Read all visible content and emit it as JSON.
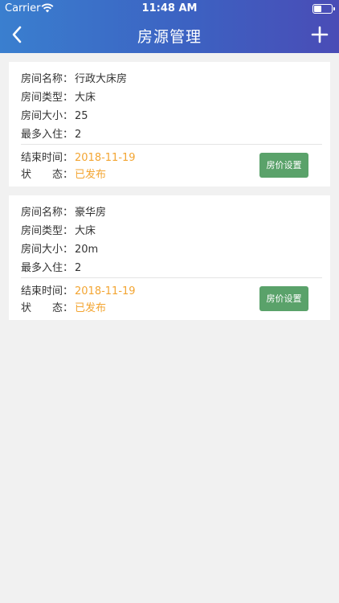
{
  "status_bar": {
    "carrier": "Carrier",
    "time": "11:48 AM"
  },
  "nav": {
    "title": "房源管理",
    "back_icon": "chevron-left-icon",
    "add_icon": "plus-icon"
  },
  "rooms": [
    {
      "name_label": "房间名称：",
      "name": "行政大床房",
      "type_label": "房间类型：",
      "type": "大床",
      "size_label": "房间大小：",
      "size": "25",
      "max_label": "最多入住：",
      "max": "2",
      "end_label": "结束时间：",
      "end_time": "2018-11-19",
      "status_label": "状　　态：",
      "status": "已发布",
      "button": "房价设置"
    },
    {
      "name_label": "房间名称：",
      "name": "豪华房",
      "type_label": "房间类型：",
      "type": "大床",
      "size_label": "房间大小：",
      "size": "20m",
      "max_label": "最多入住：",
      "max": "2",
      "end_label": "结束时间：",
      "end_time": "2018-11-19",
      "status_label": "状　　态：",
      "status": "已发布",
      "button": "房价设置"
    }
  ],
  "colors": {
    "header_start": "#3a7fcf",
    "header_end": "#4a4cb6",
    "accent_orange": "#f3a532",
    "button_green": "#5aa26a",
    "background": "#f1f1f1"
  }
}
